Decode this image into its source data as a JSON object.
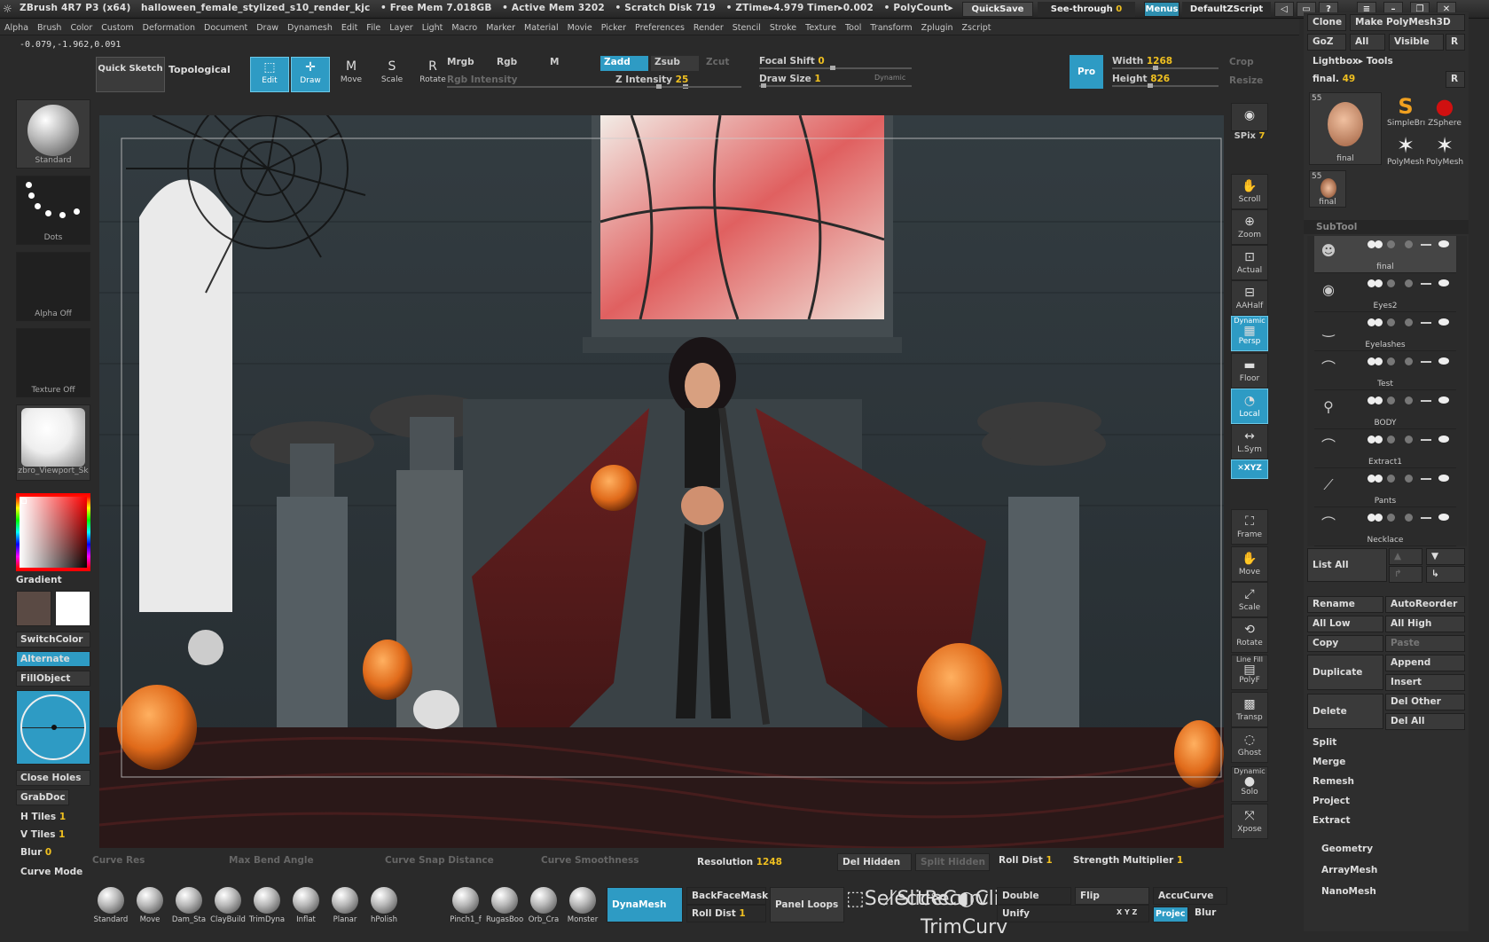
{
  "titlebar": {
    "app": "ZBrush 4R7 P3 (x64)",
    "document": "halloween_female_stylized_s10_render_kjc",
    "free_mem": "• Free Mem 7.018GB",
    "active_mem": "• Active Mem 3202",
    "scratch": "• Scratch Disk 719",
    "ztime": "• ZTime▸4.979 Timer▸0.002",
    "polycount": "• PolyCount▸",
    "quicksave": "QuickSave",
    "seethrough": "See-through",
    "seethrough_val": "0",
    "menus": "Menus",
    "script": "DefaultZScript"
  },
  "menubar": [
    "Alpha",
    "Brush",
    "Color",
    "Custom",
    "Deformation",
    "Document",
    "Draw",
    "Dynamesh",
    "Edit",
    "File",
    "Layer",
    "Light",
    "Macro",
    "Marker",
    "Material",
    "Movie",
    "Picker",
    "Preferences",
    "Render",
    "Stencil",
    "Stroke",
    "Texture",
    "Tool",
    "Transform",
    "Zplugin",
    "Zscript"
  ],
  "coords": "-0.079,-1.962,0.091",
  "toolbar": {
    "quick_sketch": "Quick Sketch",
    "topological": "Topological",
    "edit": "Edit",
    "draw": "Draw",
    "move": "Move",
    "scale": "Scale",
    "rotate": "Rotate",
    "mrgb": "Mrgb",
    "rgb": "Rgb",
    "m": "M",
    "rgb_intensity": "Rgb Intensity",
    "zadd": "Zadd",
    "zsub": "Zsub",
    "zcut": "Zcut",
    "z_intensity_label": "Z Intensity",
    "z_intensity": "25",
    "focal_shift_label": "Focal Shift",
    "focal_shift": "0",
    "draw_size_label": "Draw Size",
    "draw_size": "1",
    "dynamic": "Dynamic",
    "pro": "Pro",
    "width_label": "Width",
    "width": "1268",
    "height_label": "Height",
    "height": "826",
    "crop": "Crop",
    "resize": "Resize"
  },
  "left": {
    "standard": "Standard",
    "dots": "Dots",
    "alpha_off": "Alpha Off",
    "texture_off": "Texture Off",
    "material": "zbro_Viewport_Sk",
    "gradient": "Gradient",
    "switchcolor": "SwitchColor",
    "alternate": "Alternate",
    "fillobject": "FillObject",
    "close_holes": "Close Holes",
    "grabdoc": "GrabDoc",
    "h_tiles_label": "H Tiles",
    "h_tiles": "1",
    "v_tiles_label": "V Tiles",
    "v_tiles": "1",
    "blur_label": "Blur",
    "blur": "0",
    "curve_mode": "Curve Mode",
    "main_color": "#5a4a44",
    "secondary_color": "#ffffff"
  },
  "right_shelf": {
    "bpr": "BPR",
    "spix_label": "SPix",
    "spix": "7",
    "scroll": "Scroll",
    "zoom": "Zoom",
    "actual": "Actual",
    "aahalf": "AAHalf",
    "dynamic": "Dynamic",
    "persp": "Persp",
    "floor": "Floor",
    "local": "Local",
    "lsym": "L.Sym",
    "xyz": "✕XYZ",
    "frame": "Frame",
    "move": "Move",
    "scale": "Scale",
    "rotate": "Rotate",
    "line_fill": "Line Fill",
    "polyf": "PolyF",
    "transp": "Transp",
    "ghost": "Ghost",
    "dynamic2": "Dynamic",
    "solo": "Solo",
    "xpose": "Xpose"
  },
  "tool_panel": {
    "clone": "Clone",
    "make_polymesh": "Make PolyMesh3D",
    "goz": "GoZ",
    "all": "All",
    "visible": "Visible",
    "r": "R",
    "lightbox_tools": "Lightbox▸ Tools",
    "final_label": "final.",
    "final_val": "49",
    "thumb_count": "55",
    "thumb_final": "final",
    "simplebr": "SimpleBrı",
    "zsphere": "ZSphere",
    "polymesh1": "PolyMesh",
    "polymesh2": "PolyMesh",
    "thumb2_count": "55",
    "thumb2_final": "final",
    "subtool_title": "SubTool",
    "subtools": [
      {
        "name": "final"
      },
      {
        "name": "Eyes2"
      },
      {
        "name": "Eyelashes"
      },
      {
        "name": "Test"
      },
      {
        "name": "BODY"
      },
      {
        "name": "Extract1"
      },
      {
        "name": "Pants"
      },
      {
        "name": "Necklace"
      }
    ],
    "list_all": "List  All",
    "rename": "Rename",
    "autoreorder": "AutoReorder",
    "all_low": "All  Low",
    "all_high": "All  High",
    "copy": "Copy",
    "paste": "Paste",
    "duplicate": "Duplicate",
    "append": "Append",
    "insert": "Insert",
    "delete": "Delete",
    "del_other": "Del  Other",
    "del_all": "Del  All",
    "split": "Split",
    "merge": "Merge",
    "remesh": "Remesh",
    "project": "Project",
    "extract": "Extract",
    "geometry": "Geometry",
    "arraymesh": "ArrayMesh",
    "nanomesh": "NanoMesh"
  },
  "bottom": {
    "curve_res": "Curve Res",
    "max_bend": "Max Bend Angle",
    "curve_snap": "Curve Snap Distance",
    "curve_smooth": "Curve Smoothness",
    "resolution_label": "Resolution",
    "resolution": "1248",
    "del_hidden": "Del Hidden",
    "split_hidden": "Split Hidden",
    "roll_dist_label": "Roll Dist",
    "roll_dist": "1",
    "strength_label": "Strength Multiplier",
    "strength": "1"
  },
  "brushes": [
    "Standard",
    "Move",
    "Dam_Sta",
    "ClayBuild",
    "TrimDyna",
    "Inflat",
    "Planar",
    "hPolish",
    "Pinch1_f",
    "RugasBoo",
    "Orb_Cra",
    "Monster"
  ],
  "brushbar": {
    "dynamesh": "DynaMesh",
    "backfacemask": "BackFaceMask",
    "roll_dist_label": "Roll Dist",
    "roll_dist": "1",
    "panel_loops": "Panel Loops",
    "selectrec": "SelectRec",
    "slicecurv": "SliceCurv",
    "trimcurv": "TrimCurv",
    "clipcurve": "ClipCurve",
    "double": "Double",
    "flip": "Flip",
    "accucurve": "AccuCurve",
    "unify": "Unify",
    "xyz": "X Y Z",
    "project": "Projec",
    "blur": "Blur"
  }
}
